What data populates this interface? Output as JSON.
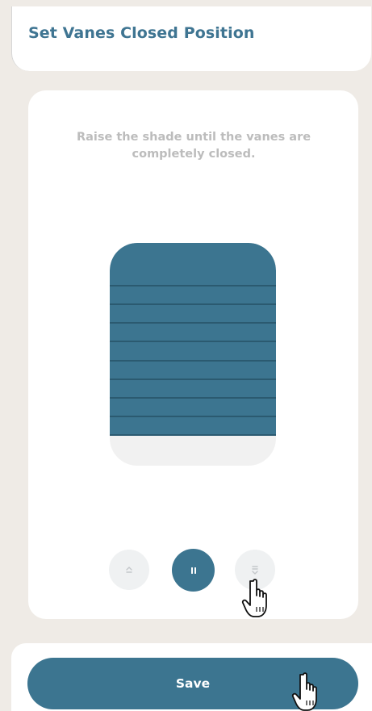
{
  "header": {
    "title": "Set Vanes Closed Position"
  },
  "card": {
    "instruction": "Raise the shade until the vanes are completely closed."
  },
  "shade": {
    "vane_count": 9,
    "color": "#3c7590"
  },
  "controls": {
    "raise_icon": "chevron-up-icon",
    "pause_icon": "pause-icon",
    "lower_icon": "chevron-down-icon"
  },
  "footer": {
    "save_label": "Save"
  },
  "colors": {
    "accent": "#3c7590",
    "title": "#3f7592",
    "background": "#efebe6"
  }
}
